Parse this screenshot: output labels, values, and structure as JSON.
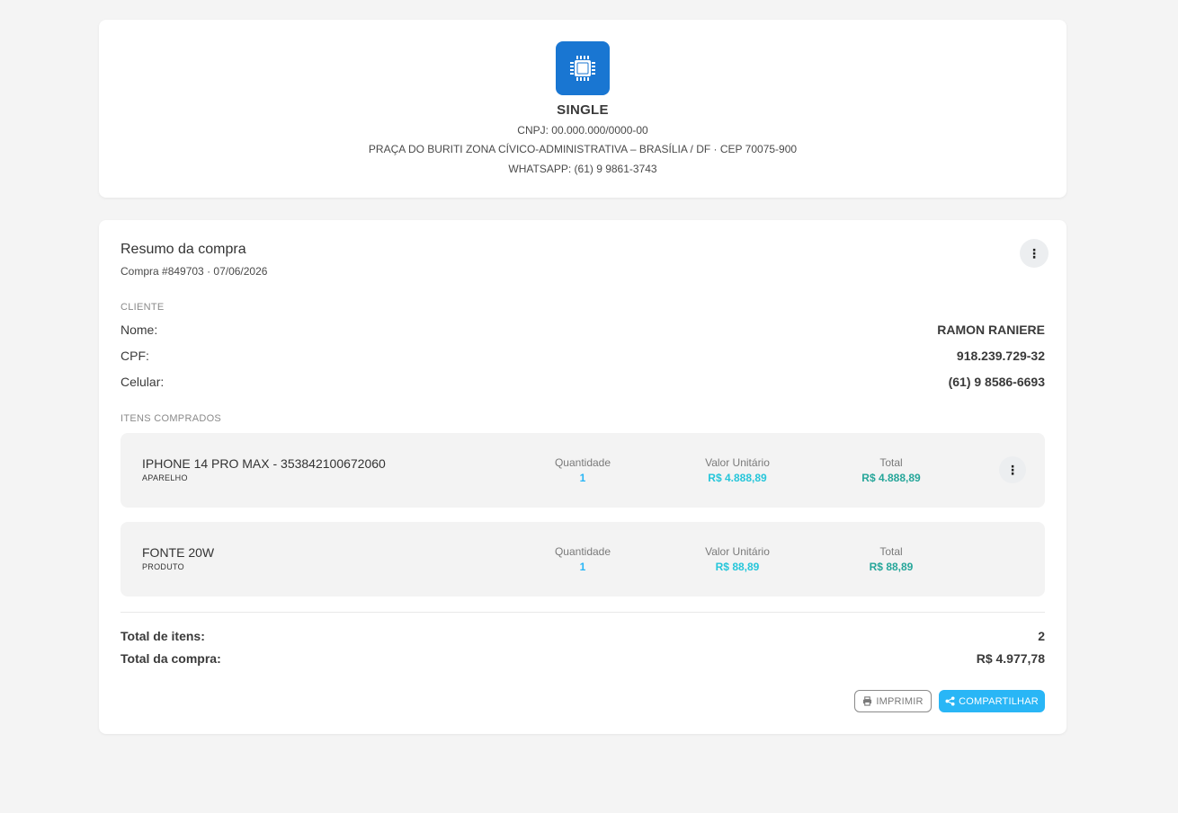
{
  "store": {
    "name": "SINGLE",
    "cnpj": "CNPJ: 00.000.000/0000-00",
    "address": "PRAÇA DO BURITI ZONA CÍVICO-ADMINISTRATIVA – BRASÍLIA / DF · CEP 70075-900",
    "whatsapp": "WHATSAPP: (61) 9 9861-3743",
    "logo_icon": "chip-icon",
    "brand_color": "#1976d2"
  },
  "summary": {
    "title": "Resumo da compra",
    "subtitle": "Compra #849703 · 07/06/2026",
    "menu_icon": "more-vert-icon"
  },
  "client": {
    "section_label": "CLIENTE",
    "name_label": "Nome:",
    "name_value": "RAMON RANIERE",
    "cpf_label": "CPF:",
    "cpf_value": "918.239.729-32",
    "phone_label": "Celular:",
    "phone_value": "(61) 9 8586-6693"
  },
  "items_section": {
    "label": "ITENS COMPRADOS",
    "qty_header": "Quantidade",
    "unit_header": "Valor Unitário",
    "total_header": "Total",
    "items": [
      {
        "name": "IPHONE 14 PRO MAX - 353842100672060",
        "type": "APARELHO",
        "qty": "1",
        "unit": "R$ 4.888,89",
        "total": "R$ 4.888,89"
      },
      {
        "name": "FONTE 20W",
        "type": "PRODUTO",
        "qty": "1",
        "unit": "R$ 88,89",
        "total": "R$ 88,89"
      }
    ]
  },
  "totals": {
    "items_label": "Total de itens:",
    "items_value": "2",
    "purchase_label": "Total da compra:",
    "purchase_value": "R$ 4.977,78"
  },
  "actions": {
    "print_label": "IMPRIMIR",
    "share_label": "COMPARTILHAR",
    "accent_color": "#29b6f6"
  }
}
